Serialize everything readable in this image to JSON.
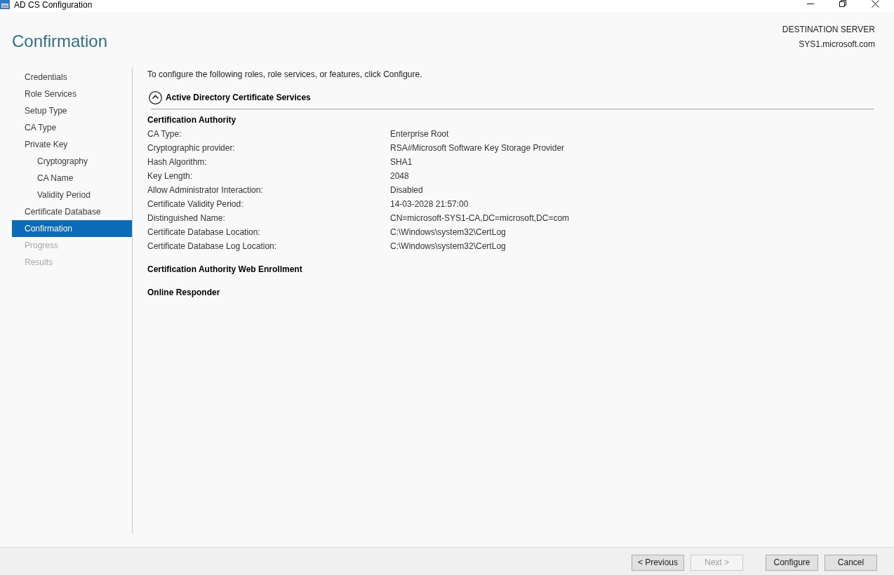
{
  "window": {
    "title": "AD CS Configuration"
  },
  "header": {
    "title": "Confirmation",
    "destination_label": "DESTINATION SERVER",
    "destination_server": "SYS1.microsoft.com"
  },
  "sidebar": {
    "items": [
      {
        "label": "Credentials",
        "selected": false,
        "disabled": false
      },
      {
        "label": "Role Services",
        "selected": false,
        "disabled": false
      },
      {
        "label": "Setup Type",
        "selected": false,
        "disabled": false
      },
      {
        "label": "CA Type",
        "selected": false,
        "disabled": false
      },
      {
        "label": "Private Key",
        "selected": false,
        "disabled": false,
        "children": [
          {
            "label": "Cryptography",
            "selected": false,
            "disabled": false
          },
          {
            "label": "CA Name",
            "selected": false,
            "disabled": false
          },
          {
            "label": "Validity Period",
            "selected": false,
            "disabled": false
          }
        ]
      },
      {
        "label": "Certificate Database",
        "selected": false,
        "disabled": false
      },
      {
        "label": "Confirmation",
        "selected": true,
        "disabled": false
      },
      {
        "label": "Progress",
        "selected": false,
        "disabled": true
      },
      {
        "label": "Results",
        "selected": false,
        "disabled": true
      }
    ]
  },
  "content": {
    "intro": "To configure the following roles, role services, or features, click Configure.",
    "sections": [
      {
        "title": "Active Directory Certificate Services",
        "expanded": true,
        "groups": [
          {
            "title": "Certification Authority",
            "rows": [
              {
                "label": "CA Type:",
                "value": "Enterprise Root"
              },
              {
                "label": "Cryptographic provider:",
                "value": "RSA#Microsoft Software Key Storage Provider"
              },
              {
                "label": "Hash Algorithm:",
                "value": "SHA1"
              },
              {
                "label": "Key Length:",
                "value": "2048"
              },
              {
                "label": "Allow Administrator Interaction:",
                "value": "Disabled"
              },
              {
                "label": "Certificate Validity Period:",
                "value": "14-03-2028 21:57:00"
              },
              {
                "label": "Distinguished Name:",
                "value": "CN=microsoft-SYS1-CA,DC=microsoft,DC=com"
              },
              {
                "label": "Certificate Database Location:",
                "value": "C:\\Windows\\system32\\CertLog"
              },
              {
                "label": "Certificate Database Log Location:",
                "value": "C:\\Windows\\system32\\CertLog"
              }
            ]
          },
          {
            "title": "Certification Authority Web Enrollment"
          },
          {
            "title": "Online Responder"
          }
        ]
      }
    ]
  },
  "navigation_buttons": [
    {
      "label": "< Previous",
      "disabled": false
    },
    {
      "label": "Next >",
      "disabled": true
    }
  ],
  "action_buttons": [
    {
      "label": "Configure",
      "disabled": false
    },
    {
      "label": "Cancel",
      "disabled": false
    }
  ]
}
